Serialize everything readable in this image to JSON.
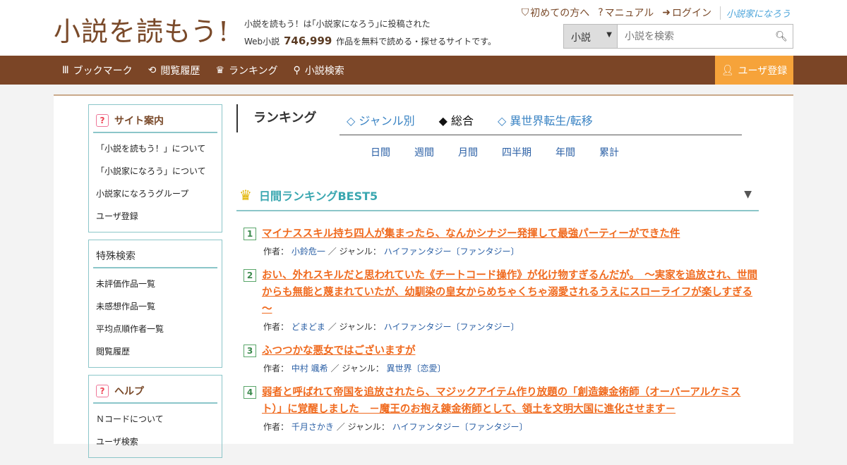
{
  "header": {
    "logo": "小説を読もう!",
    "tagline_line1": "小説を読もう！は｢小説家になろう｣に投稿された",
    "tagline_prefix": "Web小説",
    "count": "746,999",
    "tagline_suffix": "作品を無料で読める・探せるサイトです。",
    "links": [
      "初めての方へ",
      "マニュアル",
      "ログイン"
    ],
    "narou_logo": "小説家になろう",
    "search_select": "小説",
    "search_placeholder": "小説を検索"
  },
  "nav": {
    "items": [
      "ブックマーク",
      "閲覧履歴",
      "ランキング",
      "小説検索"
    ],
    "register": "ユーザ登録"
  },
  "sidebar": {
    "box1": {
      "title": "サイト案内",
      "items": [
        "「小説を読もう！」について",
        "「小説家になろう」について",
        "小説家になろうグループ",
        "ユーザ登録"
      ]
    },
    "box2": {
      "title": "特殊検索",
      "items": [
        "未評価作品一覧",
        "未感想作品一覧",
        "平均点順作者一覧",
        "閲覧履歴"
      ]
    },
    "box3": {
      "title": "ヘルプ",
      "items": [
        "Ｎコードについて",
        "ユーザ検索"
      ]
    }
  },
  "ranking": {
    "title": "ランキング",
    "tabs": [
      "◇ ジャンル別",
      "◆ 総合",
      "◇ 異世界転生/転移"
    ],
    "periods": [
      "日間",
      "週間",
      "月間",
      "四半期",
      "年間",
      "累計"
    ],
    "best_title": "日間ランキングBEST5",
    "author_label": "作者：",
    "genre_label": "／ ジャンル：",
    "items": [
      {
        "rank": "1",
        "title": "マイナススキル持ち四人が集まったら、なんかシナジー発揮して最強パーティーができた件",
        "author": "小鈴危一",
        "genre": "ハイファンタジー〔ファンタジー〕"
      },
      {
        "rank": "2",
        "title": "おい、外れスキルだと思われていた《チートコード操作》が化け物すぎるんだが。　～実家を追放され、世間からも無能と蔑まれていたが、幼馴染の皇女からめちゃくちゃ溺愛されるうえにスローライフが楽しすぎる～",
        "author": "どまどま",
        "genre": "ハイファンタジー〔ファンタジー〕"
      },
      {
        "rank": "3",
        "title": "ふつつかな悪女ではございますが",
        "author": "中村 颯希",
        "genre": "異世界〔恋愛〕"
      },
      {
        "rank": "4",
        "title": "弱者と呼ばれて帝国を追放されたら、マジックアイテム作り放題の「創造錬金術師（オーバーアルケミスト）」に覚醒しました　－魔王のお抱え錬金術師として、領土を文明大国に進化させます－",
        "author": "千月さかき",
        "genre": "ハイファンタジー〔ファンタジー〕"
      }
    ]
  }
}
